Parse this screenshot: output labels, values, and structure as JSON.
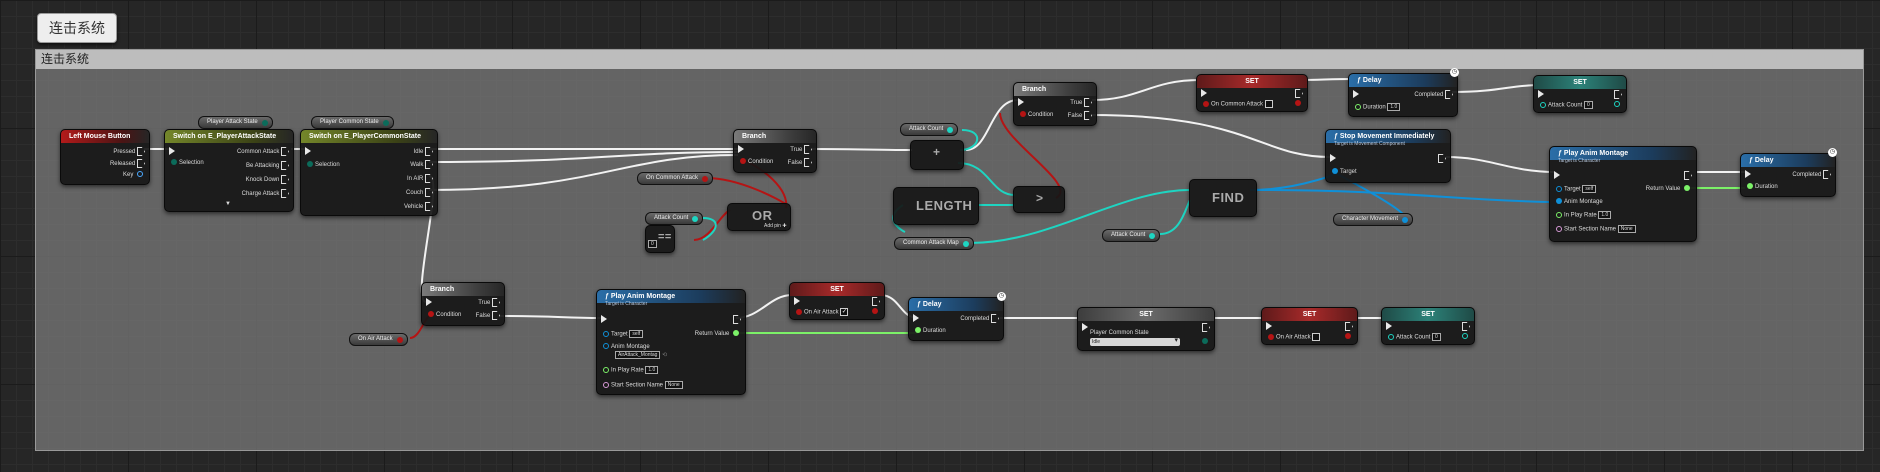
{
  "comment_bubble": "连击系统",
  "comment_header": "连击系统",
  "nodes": {
    "left_mouse": {
      "title": "Left Mouse Button",
      "pins": [
        "Pressed",
        "Released",
        "Key"
      ]
    },
    "switch_attack": {
      "title": "Switch on E_PlayerAttackState",
      "input_pin": "Selection",
      "pins": [
        "Common Attack",
        "Be Attacking",
        "Knock Down",
        "Charge Attack"
      ],
      "expand_arrow": "▼"
    },
    "switch_common": {
      "title": "Switch on E_PlayerCommonState",
      "input_pin": "Selection",
      "pins": [
        "Idle",
        "Walk",
        "In AIR",
        "Couch",
        "Vehicle"
      ]
    },
    "branch1": {
      "title": "Branch",
      "condition": "Condition",
      "outs": [
        "True",
        "False"
      ]
    },
    "branch2": {
      "title": "Branch",
      "condition": "Condition",
      "outs": [
        "True",
        "False"
      ]
    },
    "branch3": {
      "title": "Branch",
      "condition": "Condition",
      "outs": [
        "True",
        "False"
      ]
    },
    "or_node": {
      "label": "OR",
      "add_pin": "Add pin"
    },
    "equal_node": {
      "label": "==",
      "value": "0"
    },
    "add_node": {
      "label": "+",
      "value": "1"
    },
    "greater_node": {
      "label": ">"
    },
    "length_node": {
      "label": "LENGTH"
    },
    "find_node": {
      "label": "FIND"
    },
    "set_common_attack": {
      "title": "SET",
      "pin": "On Common Attack"
    },
    "set_air_attack_top": {
      "title": "SET",
      "pin": "On Air Attack"
    },
    "delay_top": {
      "title": "Delay",
      "completed": "Completed",
      "duration": "Duration",
      "duration_value": "1.0"
    },
    "set_attack_count_top": {
      "title": "SET",
      "pin": "Attack Count",
      "value": "0"
    },
    "stop_movement": {
      "title": "Stop Movement Immediately",
      "subtitle": "Target is Movement Component",
      "target": "Target"
    },
    "play_montage_right": {
      "title": "Play Anim Montage",
      "subtitle": "Target is Character",
      "target": "Target",
      "target_value": "self",
      "return": "Return Value",
      "anim": "Anim Montage",
      "rate": "In Play Rate",
      "rate_value": "1.0",
      "section": "Start Section Name",
      "section_value": "None"
    },
    "delay_right": {
      "title": "Delay",
      "completed": "Completed",
      "duration": "Duration"
    },
    "play_montage_bottom": {
      "title": "Play Anim Montage",
      "subtitle": "Target is Character",
      "target": "Target",
      "target_value": "self",
      "return": "Return Value",
      "anim": "Anim Montage",
      "anim_value": "AirAttack_Montag",
      "rate": "In Play Rate",
      "rate_value": "1.0",
      "section": "Start Section Name",
      "section_value": "None"
    },
    "set_air_attack_mid": {
      "title": "SET",
      "pin": "On Air Attack",
      "checked": "✓"
    },
    "delay_bottom": {
      "title": "Delay",
      "completed": "Completed",
      "duration": "Duration"
    },
    "set_common_state": {
      "title": "SET",
      "pin": "Player Common State",
      "value": "Idle"
    },
    "set_air_attack_bottom": {
      "title": "SET",
      "pin": "On Air Attack"
    },
    "set_attack_count_bottom": {
      "title": "SET",
      "pin": "Attack Count",
      "value": "0"
    }
  },
  "variables": {
    "player_attack_state": "Player Attack State",
    "player_common_state": "Player Common State",
    "attack_count_a": "Attack Count",
    "on_common_attack": "On Common Attack",
    "attack_count_b": "Attack Count",
    "common_attack_map": "Common Attack Map",
    "attack_count_c": "Attack Count",
    "character_movement": "Character Movement",
    "on_air_attack": "On Air Attack"
  },
  "colors": {
    "exec": "#ffffff",
    "bool": "#9c1010",
    "int": "#1ed5c2",
    "object": "#0e8ed8",
    "float": "#7cf168",
    "enum": "#0b6b5a"
  },
  "latent_icon": "clock-icon"
}
